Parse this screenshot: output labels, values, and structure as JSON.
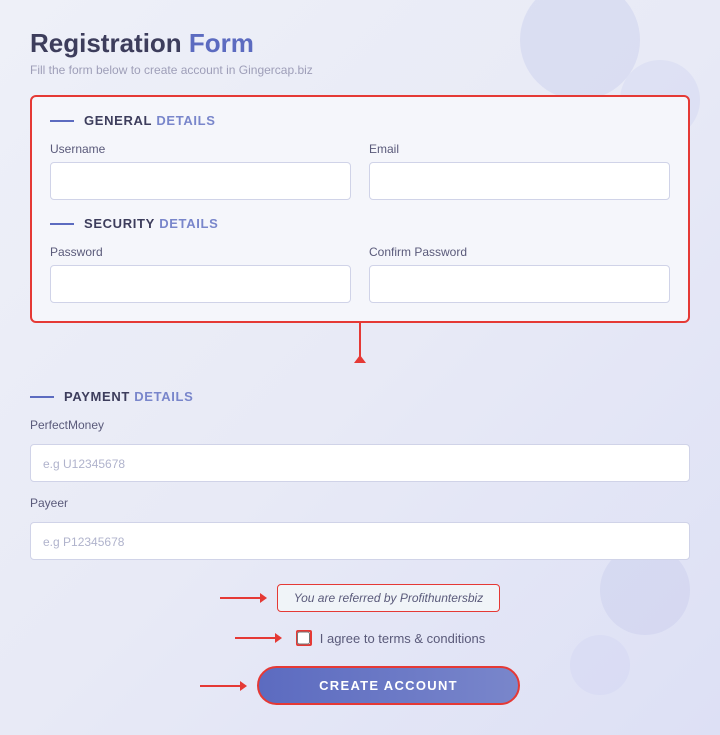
{
  "page": {
    "title_part1": "Registration",
    "title_part2": " Form",
    "subtitle": "Fill the form below to create account in Gingercap.biz"
  },
  "general_section": {
    "line": "—",
    "label_part1": "GENERAL",
    "label_part2": "DETAILS",
    "username_label": "Username",
    "email_label": "Email",
    "username_placeholder": "",
    "email_placeholder": ""
  },
  "security_section": {
    "line": "—",
    "label_part1": "SECURITY",
    "label_part2": "DETAILS",
    "password_label": "Password",
    "confirm_password_label": "Confirm Password",
    "password_placeholder": "",
    "confirm_placeholder": ""
  },
  "payment_section": {
    "line": "—",
    "label_part1": "PAYMENT",
    "label_part2": "DETAILS",
    "perfect_money_label": "PerfectMoney",
    "perfect_money_placeholder": "e.g U12345678",
    "payeer_label": "Payeer",
    "payeer_placeholder": "e.g P12345678"
  },
  "referral": {
    "text": "You are referred by Profithuntersbiz"
  },
  "terms": {
    "label": "I agree to terms & conditions"
  },
  "button": {
    "create_account": "CREATE ACCOUNT"
  }
}
